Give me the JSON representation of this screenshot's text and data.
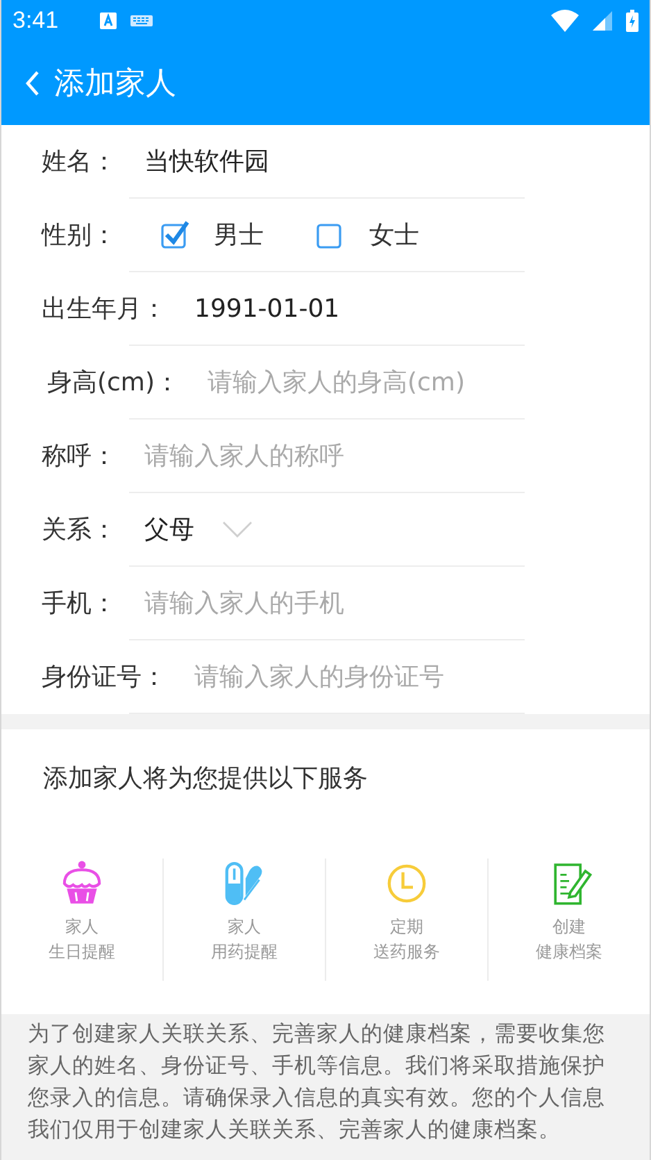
{
  "status_bar": {
    "time": "3:41"
  },
  "app_bar": {
    "title": "添加家人"
  },
  "form": {
    "fields": [
      {
        "kind": "text",
        "label": "姓名：",
        "value": "当快软件园"
      },
      {
        "kind": "choice",
        "label": "性别：",
        "options": [
          {
            "label": "男士",
            "checked": true
          },
          {
            "label": "女士",
            "checked": false
          }
        ]
      },
      {
        "kind": "text",
        "label": "出生年月：",
        "value": "1991-01-01"
      },
      {
        "kind": "text",
        "label": "身高(cm)：",
        "placeholder": "请输入家人的身高(cm)"
      },
      {
        "kind": "text",
        "label": "称呼：",
        "placeholder": "请输入家人的称呼"
      },
      {
        "kind": "select",
        "label": "关系：",
        "value": "父母"
      },
      {
        "kind": "text",
        "label": "手机：",
        "placeholder": "请输入家人的手机"
      },
      {
        "kind": "text",
        "label": "身份证号：",
        "placeholder": "请输入家人的身份证号"
      }
    ]
  },
  "services": {
    "title": "添加家人将为您提供以下服务",
    "items": [
      {
        "lines": [
          "家人",
          "生日提醒"
        ]
      },
      {
        "lines": [
          "家人",
          "用药提醒"
        ]
      },
      {
        "lines": [
          "定期",
          "送药服务"
        ]
      },
      {
        "lines": [
          "创建",
          "健康档案"
        ]
      }
    ]
  },
  "notice": {
    "text": "为了创建家人关联关系、完善家人的健康档案，需要收集您家人的姓名、身份证号、手机等信息。我们将采取措施保护您录入的信息。请确保录入信息的真实有效。您的个人信息我们仅用于创建家人关联关系、完善家人的健康档案。"
  }
}
